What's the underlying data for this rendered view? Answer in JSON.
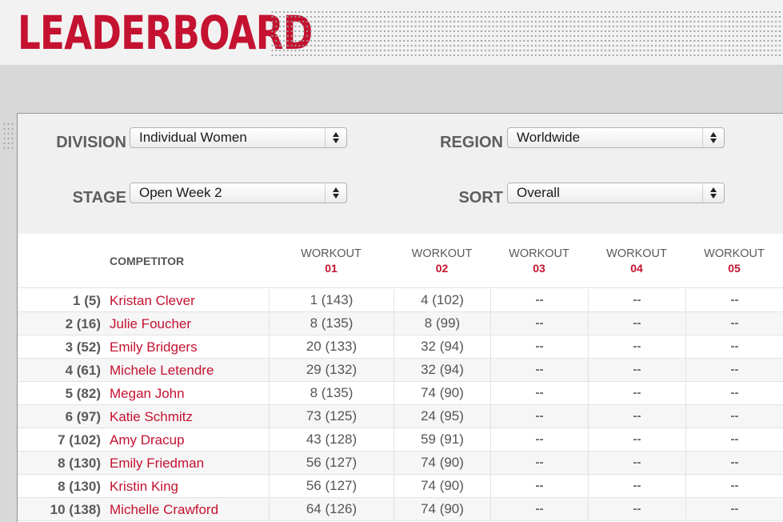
{
  "header": {
    "title": "LEADERBOARD"
  },
  "filters": {
    "division": {
      "label": "DIVISION",
      "value": "Individual Women"
    },
    "region": {
      "label": "REGION",
      "value": "Worldwide"
    },
    "stage": {
      "label": "STAGE",
      "value": "Open Week 2"
    },
    "sort": {
      "label": "SORT",
      "value": "Overall"
    }
  },
  "table": {
    "competitor_header": "COMPETITOR",
    "workout_columns": [
      {
        "label": "WORKOUT",
        "number": "01"
      },
      {
        "label": "WORKOUT",
        "number": "02"
      },
      {
        "label": "WORKOUT",
        "number": "03"
      },
      {
        "label": "WORKOUT",
        "number": "04"
      },
      {
        "label": "WORKOUT",
        "number": "05"
      }
    ],
    "rows": [
      {
        "rank": "1 (5)",
        "name": "Kristan Clever",
        "scores": [
          "1 (143)",
          "4 (102)",
          "--",
          "--",
          "--"
        ]
      },
      {
        "rank": "2 (16)",
        "name": "Julie Foucher",
        "scores": [
          "8 (135)",
          "8 (99)",
          "--",
          "--",
          "--"
        ]
      },
      {
        "rank": "3 (52)",
        "name": "Emily Bridgers",
        "scores": [
          "20 (133)",
          "32 (94)",
          "--",
          "--",
          "--"
        ]
      },
      {
        "rank": "4 (61)",
        "name": "Michele Letendre",
        "scores": [
          "29 (132)",
          "32 (94)",
          "--",
          "--",
          "--"
        ]
      },
      {
        "rank": "5 (82)",
        "name": "Megan John",
        "scores": [
          "8 (135)",
          "74 (90)",
          "--",
          "--",
          "--"
        ]
      },
      {
        "rank": "6 (97)",
        "name": "Katie Schmitz",
        "scores": [
          "73 (125)",
          "24 (95)",
          "--",
          "--",
          "--"
        ]
      },
      {
        "rank": "7 (102)",
        "name": "Amy Dracup",
        "scores": [
          "43 (128)",
          "59 (91)",
          "--",
          "--",
          "--"
        ]
      },
      {
        "rank": "8 (130)",
        "name": "Emily Friedman",
        "scores": [
          "56 (127)",
          "74 (90)",
          "--",
          "--",
          "--"
        ]
      },
      {
        "rank": "8 (130)",
        "name": "Kristin King",
        "scores": [
          "56 (127)",
          "74 (90)",
          "--",
          "--",
          "--"
        ]
      },
      {
        "rank": "10 (138)",
        "name": "Michelle Crawford",
        "scores": [
          "64 (126)",
          "74 (90)",
          "--",
          "--",
          "--"
        ]
      }
    ]
  },
  "colors": {
    "brand_red": "#c41230",
    "label_gray": "#5e5e5e"
  }
}
